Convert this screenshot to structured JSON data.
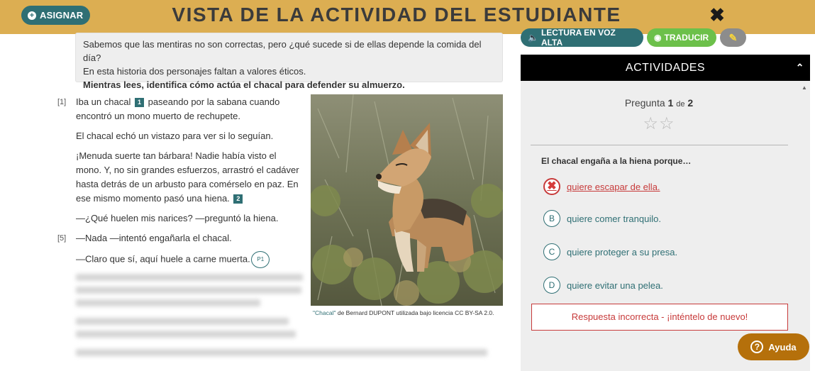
{
  "header": {
    "assign_label": "ASIGNAR",
    "title": "VISTA DE LA ACTIVIDAD DEL ESTUDIANTE",
    "close_glyph": "✖"
  },
  "intro": {
    "line1": "Sabemos que las mentiras no son correctas, pero ¿qué sucede si de ellas depende la comida del día?",
    "line2": "En esta historia dos personajes faltan a valores éticos.",
    "line3": "Mientras lees, identifica cómo actúa el chacal para defender su almuerzo."
  },
  "story": {
    "p1_num": "[1]",
    "p1_a": "Iba un chacal",
    "note1": "1",
    "p1_b": " paseando por la sabana cuando encontró un mono muerto de rechupete.",
    "p2": "El chacal echó un vistazo para ver si lo seguían.",
    "p3_a": "¡Menuda suerte tan bárbara! Nadie había visto el mono. Y, no sin grandes esfuerzos, arrastró el cadáver hasta detrás de un arbusto para comérselo en paz. En ese mismo momento pasó una hiena.",
    "note2": "2",
    "p4": "—¿Qué huelen mis narices? —preguntó la hiena.",
    "p5_num": "[5]",
    "p5": "—Nada —intentó engañarla el chacal.",
    "p6": "—Claro que sí, aquí huele a carne muerta.",
    "p6_marker": "P1"
  },
  "photo": {
    "caption_title": "\"Chacal\"",
    "caption_rest": " de Bernard DUPONT utilizada bajo licencia CC BY-SA 2.0."
  },
  "tools": {
    "read_label": "LECTURA EN VOZ ALTA",
    "translate_label": "TRADUCIR",
    "edit_glyph": "✎"
  },
  "activities": {
    "header": "ACTIVIDADES",
    "question_word": "Pregunta",
    "current": "1",
    "of_word": "de",
    "total": "2",
    "stars": "☆☆",
    "prompt": "El chacal engaña a la hiena porque…",
    "options": [
      {
        "letter": "✖",
        "text": "quiere escapar de ella."
      },
      {
        "letter": "B",
        "text": "quiere comer tranquilo."
      },
      {
        "letter": "C",
        "text": "quiere proteger a su presa."
      },
      {
        "letter": "D",
        "text": "quiere evitar una pelea."
      }
    ],
    "feedback": "Respuesta incorrecta - ¡inténtelo de nuevo!"
  },
  "help_label": "Ayuda",
  "colors": {
    "header_bg": "#dcae52",
    "teal": "#2f6f74",
    "green": "#6cc04a",
    "error": "#c73a3a",
    "help_bg": "#b5700b"
  }
}
